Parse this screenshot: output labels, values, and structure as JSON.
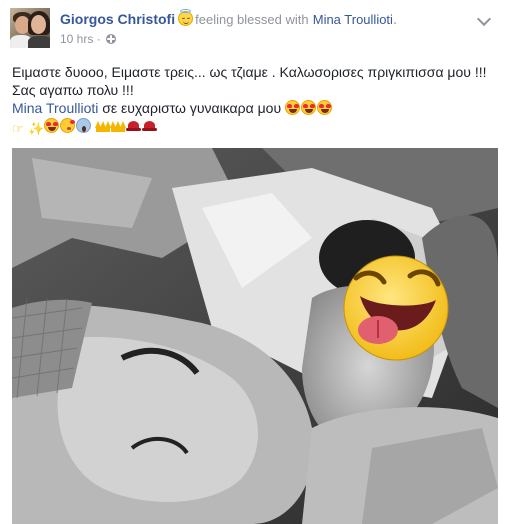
{
  "post": {
    "author": "Giorgos Christofi",
    "feeling": "feeling blessed with",
    "tagged": "Mina Troullioti",
    "period": ".",
    "timestamp": "10 hrs",
    "separator": "·",
    "text_line1": "Ειμαστε δυοοο, Ειμαστε τρεις... ως τζιαμε . Καλωσορισες πριγκιπισσα μου !!!",
    "text_line2": "Σας αγαπω πολυ !!!",
    "mention": "Mina Troullioti",
    "text_line3": "σε ευχαριστω γυναικαρα μου",
    "icons": {
      "feeling": "angel-emoji",
      "privacy": "globe-icon",
      "menu": "chevron-down-icon",
      "photo_overlay": "laughing-tongue-emoji"
    },
    "colors": {
      "link": "#365899",
      "meta": "#90949c",
      "text": "#1d2129"
    }
  }
}
